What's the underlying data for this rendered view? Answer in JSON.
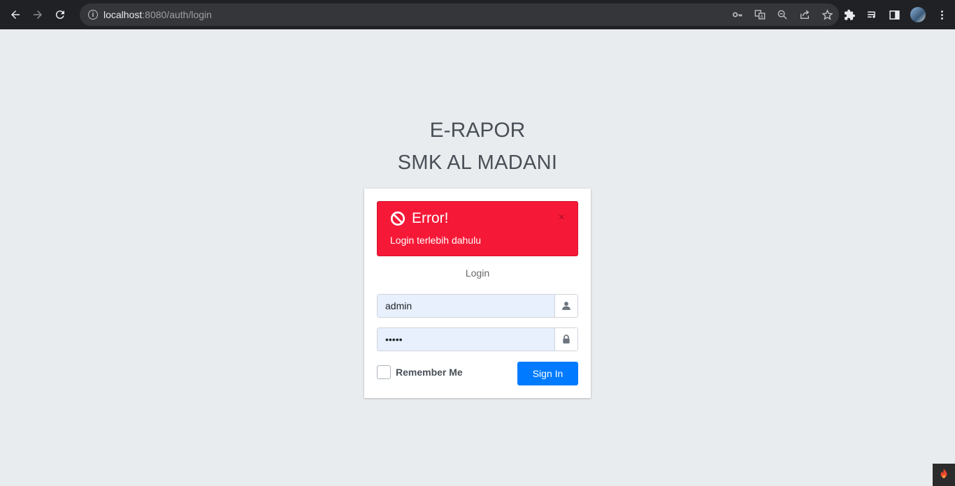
{
  "browser": {
    "url_host": "localhost",
    "url_path": ":8080/auth/login"
  },
  "icons": {
    "back": "arrow-left",
    "forward": "arrow-right",
    "reload": "reload",
    "site_info": "info",
    "key": "key",
    "translate": "translate",
    "zoom": "magnifier",
    "share": "share",
    "bookmark": "star",
    "extensions": "puzzle",
    "reading_list": "playlist",
    "side_panel": "side-panel",
    "menu": "kebab",
    "ban": "ban",
    "user": "user",
    "lock": "lock",
    "flame": "flame"
  },
  "login": {
    "title": "E-RAPOR",
    "subtitle": "SMK AL MADANI",
    "alert": {
      "title": "Error!",
      "message": "Login terlebih dahulu",
      "close": "×",
      "color": "#f51937"
    },
    "box_message": "Login",
    "username_value": "admin",
    "password_value": "•••••",
    "remember_label": "Remember Me",
    "signin_label": "Sign In",
    "primary_color": "#007bff"
  }
}
